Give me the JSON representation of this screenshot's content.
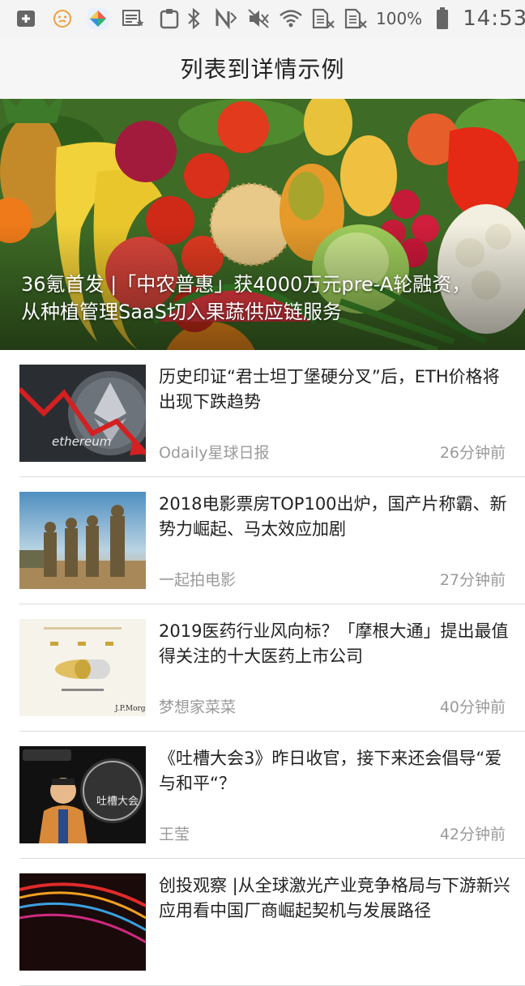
{
  "status_bar": {
    "battery": "100%",
    "time": "14:53"
  },
  "app_bar": {
    "title": "列表到详情示例"
  },
  "hero": {
    "caption_line1": "36氪首发 |「中农普惠」获4000万元pre-A轮融资，",
    "caption_line2": "从种植管理SaaS切入果蔬供应链服务"
  },
  "articles": [
    {
      "title": "历史印证“君士坦丁堡硬分叉”后，ETH价格将出现下跌趋势",
      "source": "Odaily星球日报",
      "time": "26分钟前",
      "thumb_text": "ethereum"
    },
    {
      "title": "2018电影票房TOP100出炉，国产片称霸、新势力崛起、马太效应加剧",
      "source": "一起拍电影",
      "time": "27分钟前"
    },
    {
      "title": "2019医药行业风向标？「摩根大通」提出最值得关注的十大医药上市公司",
      "source": "梦想家菜菜",
      "time": "40分钟前",
      "thumb_text": "J.P.Morgan"
    },
    {
      "title": "《吐槽大会3》昨日收官，接下来还会倡导“爱与和平“？",
      "source": "王莹",
      "time": "42分钟前",
      "thumb_text": "吐槽大会"
    },
    {
      "title": "创投观察 |从全球激光产业竞争格局与下游新兴应用看中国厂商崛起契机与发展路径",
      "source": "",
      "time": ""
    }
  ]
}
